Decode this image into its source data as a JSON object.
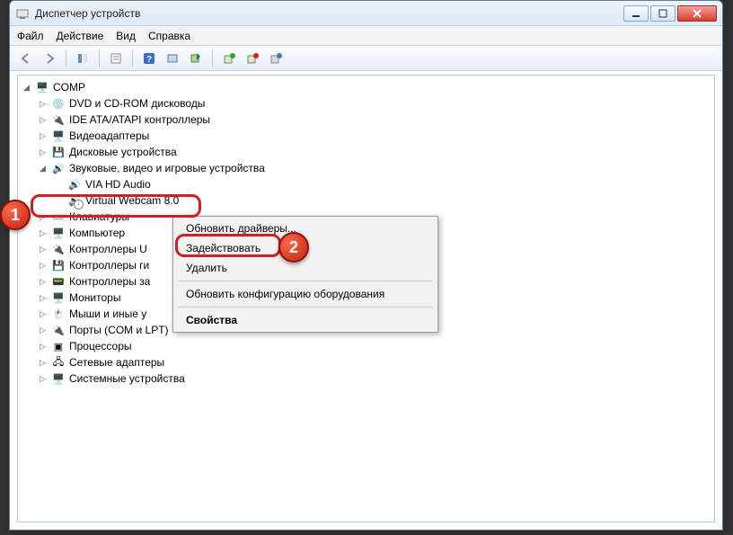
{
  "window": {
    "title": "Диспетчер устройств"
  },
  "menu": {
    "file": "Файл",
    "action": "Действие",
    "view": "Вид",
    "help": "Справка"
  },
  "tree": {
    "root": "COMP",
    "items": [
      "DVD и CD-ROM дисководы",
      "IDE ATA/ATAPI контроллеры",
      "Видеоадаптеры",
      "Дисковые устройства",
      "Звуковые, видео и игровые устройства",
      "VIA HD Audio",
      "Virtual Webcam 8.0",
      "Клавиатуры",
      "Компьютер",
      "Контроллеры U",
      "Контроллеры ги",
      "Контроллеры за",
      "Мониторы",
      "Мыши и иные у",
      "Порты (COM и LPT)",
      "Процессоры",
      "Сетевые адаптеры",
      "Системные устройства"
    ]
  },
  "context": {
    "update": "Обновить драйверы...",
    "enable": "Задействовать",
    "delete": "Удалить",
    "rescan": "Обновить конфигурацию оборудования",
    "props": "Свойства"
  },
  "badges": {
    "one": "1",
    "two": "2"
  }
}
